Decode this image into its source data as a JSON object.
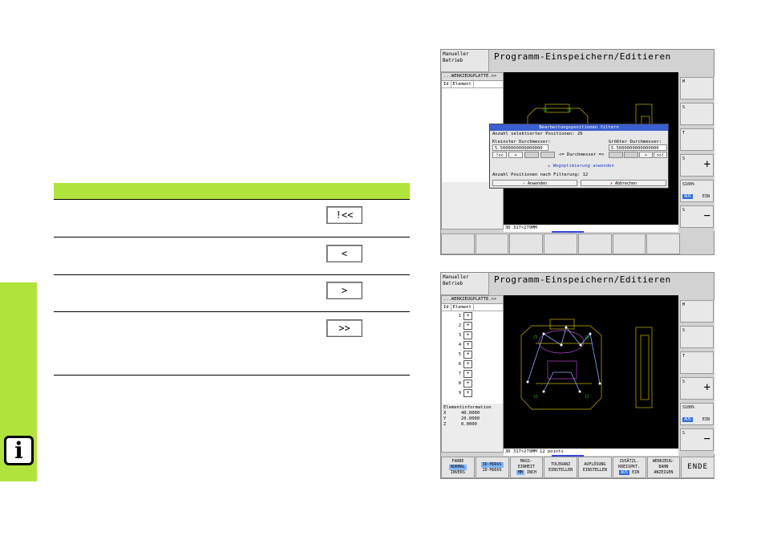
{
  "doc": {
    "info_icon": "i",
    "buttons": [
      {
        "label": "!<<"
      },
      {
        "label": "<"
      },
      {
        "label": ">"
      },
      {
        "label": ">>"
      }
    ]
  },
  "screen1": {
    "mode": "Manueller Betrieb",
    "title": "Programm-Einspeichern/Editieren",
    "tree_header": "...WERKZEUGPLATTE.>>",
    "col_id": "Id",
    "col_element": "Element",
    "status": "3D  317×279MM",
    "dialog": {
      "title": "Bearbeitungspositionen filtern",
      "count_label": "Anzahl selektierter Positionen: 26",
      "min_label": "Kleinster Durchmesser:",
      "min_value": "5.5000000000000000",
      "max_label": "Größter Durchmesser:",
      "max_value": "5.5000000000000000",
      "nav_first": "!<<",
      "nav_prev": "<",
      "nav_next": ">",
      "nav_last": ">>!",
      "diameter_label": "<= Durchmesser =>",
      "optimize_label": "Wegoptimierung anwenden",
      "filtered_label": "Anzahl Positionen nach Filterung: 12",
      "apply": "Anwenden",
      "cancel": "Abbrechen"
    },
    "softkeys": [
      "M",
      "S",
      "T",
      "S",
      "S100%",
      "S"
    ],
    "sk_aus": "AUS",
    "sk_ein": "EIN"
  },
  "screen2": {
    "mode": "Manueller Betrieb",
    "title": "Programm-Einspeichern/Editieren",
    "tree_header": "...WERKZEUGPLATTE.>>",
    "col_id": "Id",
    "col_element": "Element",
    "rows": [
      "1",
      "2",
      "3",
      "4",
      "5",
      "6",
      "7",
      "8",
      "9"
    ],
    "row_symbol": "+",
    "info_title": "Elementinformation",
    "info": [
      {
        "axis": "X",
        "value": "40.0000"
      },
      {
        "axis": "Y",
        "value": "20.0000"
      },
      {
        "axis": "Z",
        "value": "0.0000"
      }
    ],
    "status": "3D  317×279MM   12 points",
    "softkeys": [
      "M",
      "S",
      "T",
      "S",
      "S100%",
      "S"
    ],
    "sk_aus": "AUS",
    "sk_ein": "EIN",
    "bottom": {
      "farbe": "FARBE",
      "normal": "NORMAL",
      "invers": "INVERS",
      "mode3d": "3D-MODUS",
      "mode2d": "2D-MODUS",
      "mass": "MASS-",
      "einheit": "EINHEIT",
      "mm": "MM",
      "inch": "INCH",
      "toleranz": "TOLERANZ",
      "einstellen": "EINSTELLEN",
      "aufloesung": "AUFLÖSUNG",
      "einstellen2": "EINSTELLEN",
      "zusaetzl": "ZUSÄTZL.",
      "kreispkt": "KREISPKT.",
      "aus": "AUS",
      "ein": "EIN",
      "werkzeug": "WERKZEUG-",
      "bahn": "BAHN",
      "anzeigen": "ANZEIGEN",
      "ende": "ENDE"
    }
  },
  "colors": {
    "accent_green": "#b0e43c",
    "dialog_blue": "#3a5fd0"
  }
}
